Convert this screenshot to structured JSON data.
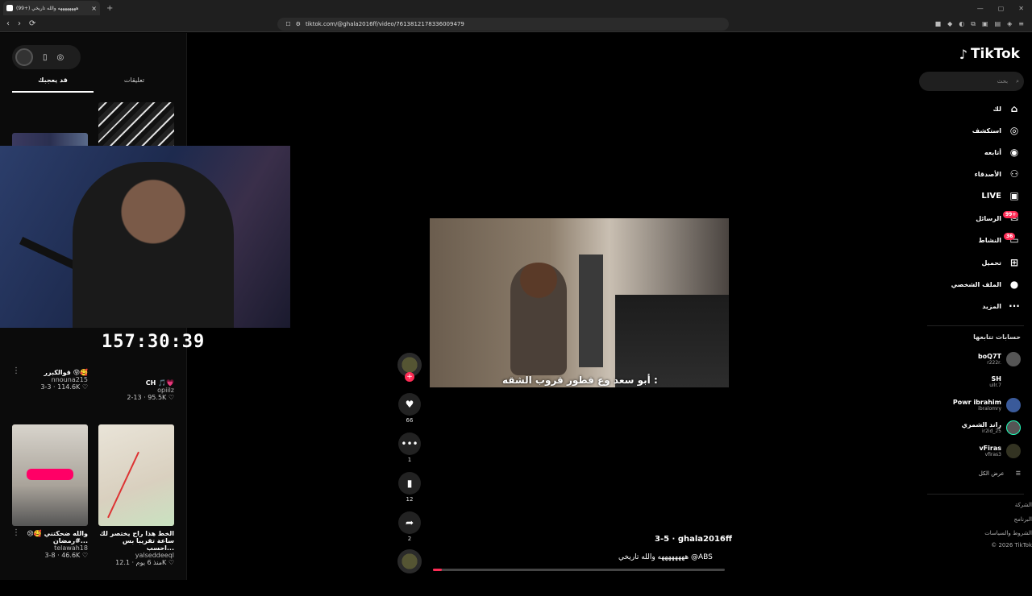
{
  "browser": {
    "tab_title": "(99+) ههههههههه والله تاريخي",
    "url": "tiktok.com/@ghala2016ff/video/7613812178336009479",
    "new_tab": "+",
    "close": "×"
  },
  "left_panel": {
    "tabs": [
      "قد يعجبك",
      "تعليقات"
    ],
    "timer": "157:30:39",
    "videos": [
      {
        "title": "قوالكبرر 😝🥰",
        "user": "nnouna215",
        "likes": "114.6K",
        "date": "3-3"
      },
      {
        "title": "CH 🎵💗",
        "user": "opiilz",
        "likes": "95.5K",
        "date": "2-13"
      },
      {
        "title": "والله ضحكتني 🥰😢 #رمضان...",
        "user": "telawah18",
        "likes": "46.6K",
        "date": "3-8"
      },
      {
        "title": "الخط هذا راح يختصر لك ساعة تقريبا بس احسب...",
        "user": "yalseddeeql",
        "likes": "12.1K",
        "date": "منذ 6 يوم"
      }
    ]
  },
  "video": {
    "subtitle": "أبو سعد وع فطور قروب الشقه :",
    "likes": "66",
    "comments": "1",
    "saves": "12",
    "shares": "2",
    "author": "ghala2016ff",
    "author_date": "3-5",
    "caption": "ههههههههه والله تاريخي @ABS",
    "progress": 0.03
  },
  "nav": {
    "brand": "TikTok",
    "search_placeholder": "بحث",
    "items": [
      "لك",
      "استكشف",
      "أتابعه",
      "الأصدقاء",
      "LIVE",
      "الرسائل",
      "النشاط",
      "تحميل",
      "الملف الشخصي",
      "المزيد"
    ],
    "messages_badge": "99+",
    "activity_badge": "36",
    "following_header": "حسابات تتابعها",
    "following": [
      {
        "name": "boQ7T",
        "handle": "r222r."
      },
      {
        "name": "SH",
        "handle": "uilr.7"
      },
      {
        "name": "Powr ibrahim",
        "handle": "ibralomry"
      },
      {
        "name": "راند الشمري",
        "handle": "ir2id_25"
      },
      {
        "name": "vFiras",
        "handle": "vfiras3"
      }
    ],
    "see_all": "عرض الكل",
    "footer": [
      "الشركة",
      "البرنامج",
      "الشروط والسياسات",
      "© 2026 TikTok"
    ]
  },
  "colors": {
    "accent": "#fe2c55",
    "background": "#000000"
  }
}
